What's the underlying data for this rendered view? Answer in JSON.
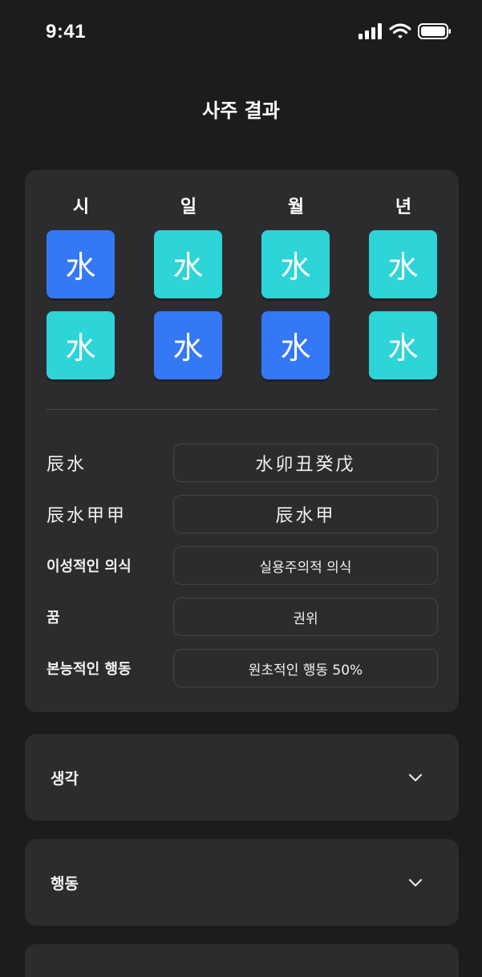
{
  "status": {
    "time": "9:41"
  },
  "title": "사주 결과",
  "pillars": {
    "headers": [
      "시",
      "일",
      "월",
      "년"
    ],
    "rows": [
      [
        {
          "glyph": "水",
          "color": "blue"
        },
        {
          "glyph": "水",
          "color": "cyan"
        },
        {
          "glyph": "水",
          "color": "cyan"
        },
        {
          "glyph": "水",
          "color": "cyan"
        }
      ],
      [
        {
          "glyph": "水",
          "color": "cyan"
        },
        {
          "glyph": "水",
          "color": "blue"
        },
        {
          "glyph": "水",
          "color": "blue"
        },
        {
          "glyph": "水",
          "color": "cyan"
        }
      ]
    ]
  },
  "info": [
    {
      "label": "辰水",
      "value": "水卯丑癸戊"
    },
    {
      "label": "辰水甲甲",
      "value": "辰水甲"
    },
    {
      "label": "이성적인 의식",
      "value": "실용주의적 의식"
    },
    {
      "label": "꿈",
      "value": "권위"
    },
    {
      "label": "본능적인 행동",
      "value": "원초적인 행동 50%"
    }
  ],
  "accordions": [
    {
      "title": "생각"
    },
    {
      "title": "행동"
    }
  ],
  "colors": {
    "background": "#1c1c1e",
    "card": "#2c2c2e",
    "blue_tile": "#3478f6",
    "cyan_tile": "#2dd4d8"
  }
}
